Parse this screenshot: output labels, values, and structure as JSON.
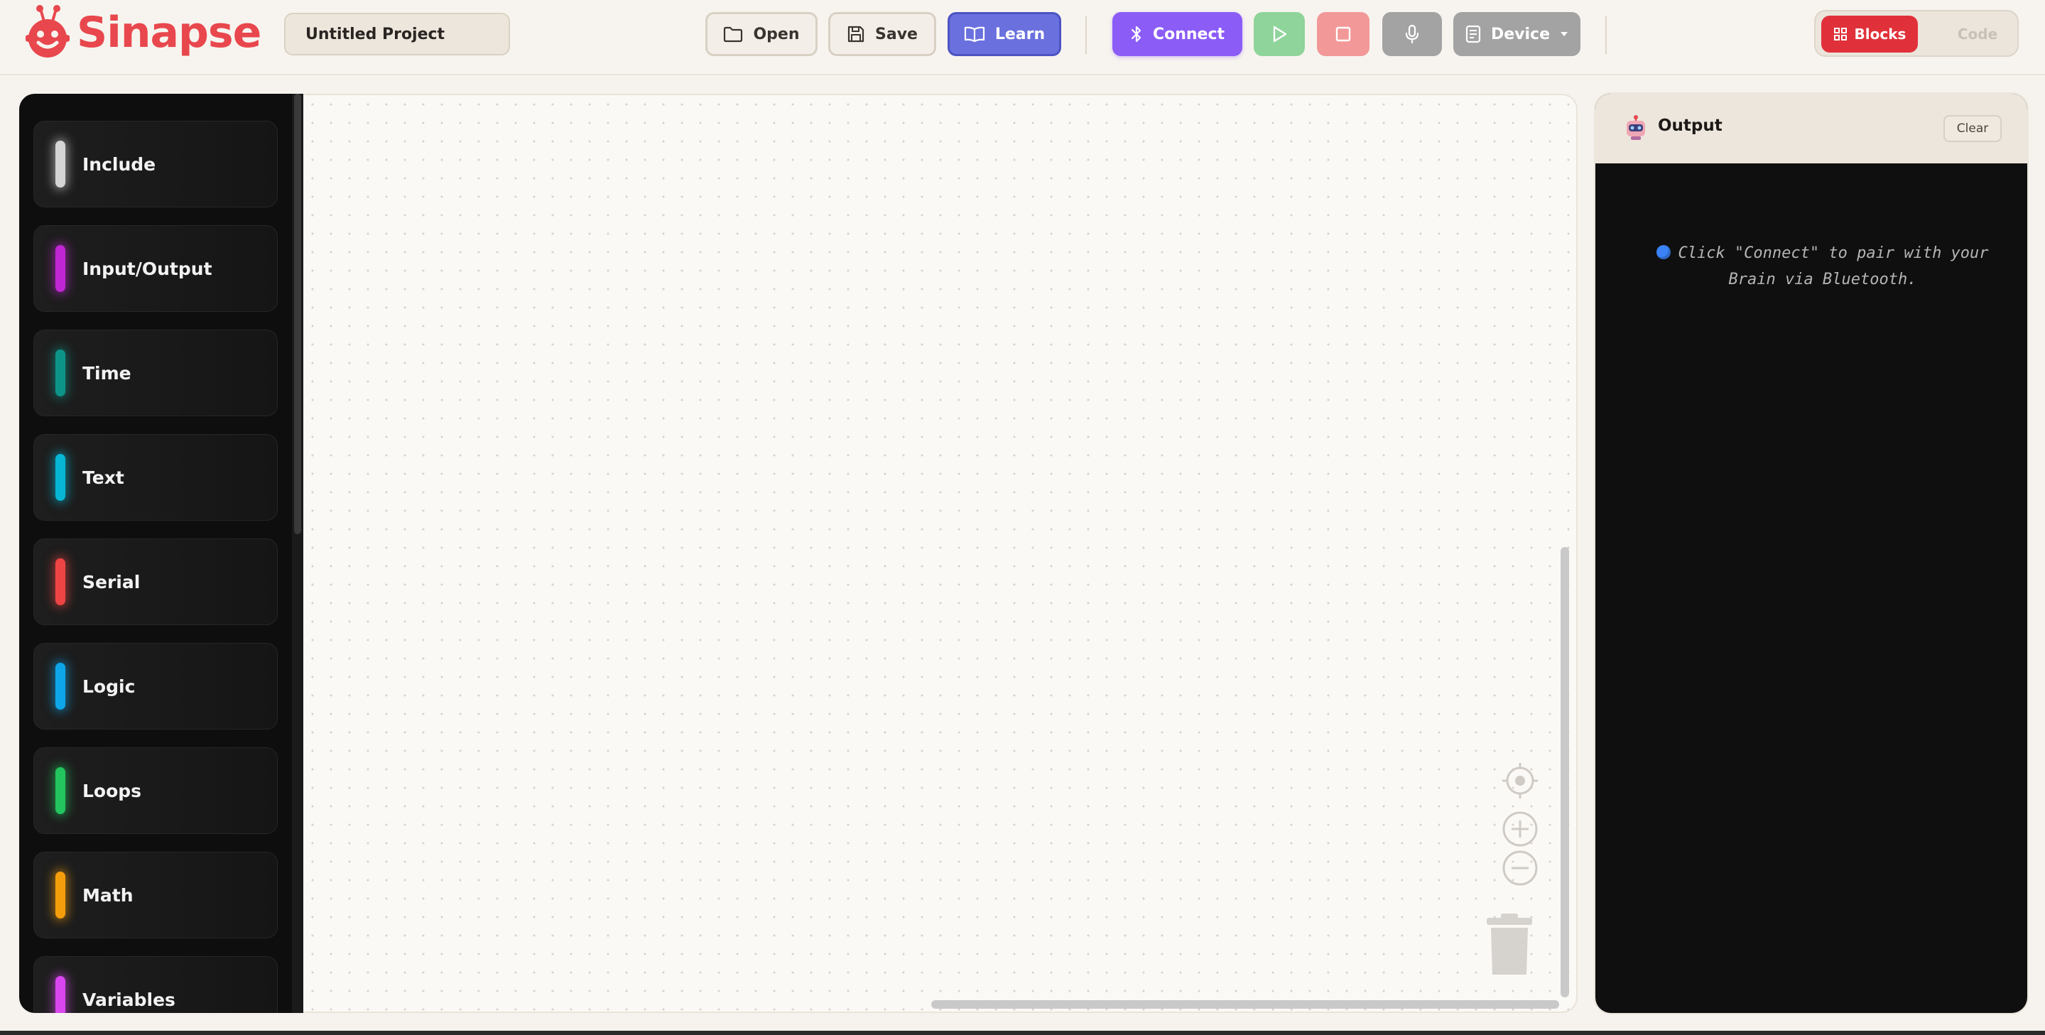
{
  "app": {
    "name": "Sinapse"
  },
  "header": {
    "project_name": "Untitled Project",
    "open_label": "Open",
    "save_label": "Save",
    "learn_label": "Learn",
    "connect_label": "Connect",
    "device_label": "Device"
  },
  "mode_toggle": {
    "blocks_label": "Blocks",
    "code_label": "Code",
    "active": "Blocks"
  },
  "toolbox": {
    "categories": [
      {
        "label": "Include",
        "color": "#d4d4d4"
      },
      {
        "label": "Input/Output",
        "color": "#c026d3"
      },
      {
        "label": "Time",
        "color": "#0d9488"
      },
      {
        "label": "Text",
        "color": "#06b6d4"
      },
      {
        "label": "Serial",
        "color": "#ef4444"
      },
      {
        "label": "Logic",
        "color": "#0ea5e9"
      },
      {
        "label": "Loops",
        "color": "#22c55e"
      },
      {
        "label": "Math",
        "color": "#f59e0b"
      },
      {
        "label": "Variables",
        "color": "#d946ef"
      }
    ]
  },
  "workspace": {
    "icons": [
      "recenter-icon",
      "zoom-in-icon",
      "zoom-out-icon",
      "trash-icon"
    ]
  },
  "output": {
    "title": "Output",
    "clear_label": "Clear",
    "message": "Click \"Connect\" to pair with your Brain via Bluetooth."
  },
  "colors": {
    "brand": "#e8474d",
    "learn": "#6a70de",
    "connect": "#8b5cf6",
    "play": "#8fd49a",
    "stop": "#f29898",
    "blocks_active": "#e0313a"
  }
}
